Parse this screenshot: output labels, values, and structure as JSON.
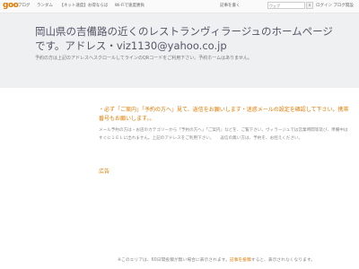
{
  "topbar": {
    "logo": "goo",
    "nav": [
      "ブログ",
      "ランダム",
      "【ネット速度】お得ならば",
      "Wi-Fiで速度勝負"
    ],
    "login": "記事を書く",
    "search_placeholder": "ウェブ",
    "user_links": "ログイン ブログ開設"
  },
  "header": {
    "title": "岡山県の吉備路の近くのレストランヴィラージュのホームページです。アドレス・viz1130@yahoo.co.jp",
    "subtitle": "予約の方は上記のアドレスへスクロールしてラインのQRコードをご利用下さい。予約ホームはありません。"
  },
  "main": {
    "notice": "・必ず「ご案内」「予約の方へ」見て、返信をお願いします・迷惑メールの設定を確認して下さい。携帯番号もお願いします。。",
    "description": "メール予約の方は・お店のカテゴリーから「予約の方へ」「ご案内」などを、ご覧下さい。ヴィラージュでは営業時間等及び、準備中はすぐに１ＥＬに出れません。上記のアドレスをご利用下さい。　　返信の無い方は、予約を、お控えください。",
    "ad_label": "広告"
  },
  "footer": {
    "text_before": "※このエリアは、60日間投稿が無い場合に表示されます。",
    "link": "記事を投稿",
    "text_after": "すると、表示されなくなります。"
  }
}
